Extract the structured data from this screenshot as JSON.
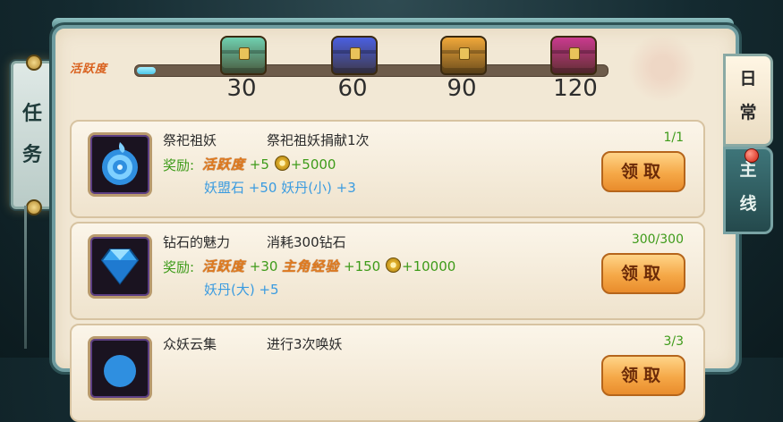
{
  "left_tab": {
    "char1": "任",
    "char2": "务"
  },
  "activity": {
    "label": "活跃度",
    "progress_fraction": 0.04
  },
  "chests": [
    {
      "value": "30",
      "color": "#6fd0b0",
      "icon": "jade-chest-icon"
    },
    {
      "value": "60",
      "color": "#4a5fe0",
      "icon": "blue-chest-icon"
    },
    {
      "value": "90",
      "color": "#f0a83a",
      "icon": "gold-chest-icon"
    },
    {
      "value": "120",
      "color": "#c93a8e",
      "icon": "magenta-chest-icon"
    }
  ],
  "right_tabs": {
    "daily": {
      "char1": "日",
      "char2": "常"
    },
    "main": {
      "char1": "主",
      "char2": "线"
    }
  },
  "reward_label": "奖励:",
  "claim_label": "领取",
  "tasks": [
    {
      "name": "祭祀祖妖",
      "desc": "祭祀祖妖捐献1次",
      "progress": "1/1",
      "icon": "blue-swirl-icon",
      "r1_tag": "活跃度",
      "r1_a": "+5",
      "r1_b": "+5000",
      "r2": "妖盟石 +50  妖丹(小) +3"
    },
    {
      "name": "钻石的魅力",
      "desc": "消耗300钻石",
      "progress": "300/300",
      "icon": "diamond-icon",
      "r1_tag": "活跃度",
      "r1_a": "+30",
      "r1_tag2": "主角经验",
      "r1_b": "+150",
      "r1_c": "+10000",
      "r2": "妖丹(大) +5"
    },
    {
      "name": "众妖云集",
      "desc": "进行3次唤妖",
      "progress": "3/3",
      "icon": "summon-icon"
    }
  ]
}
